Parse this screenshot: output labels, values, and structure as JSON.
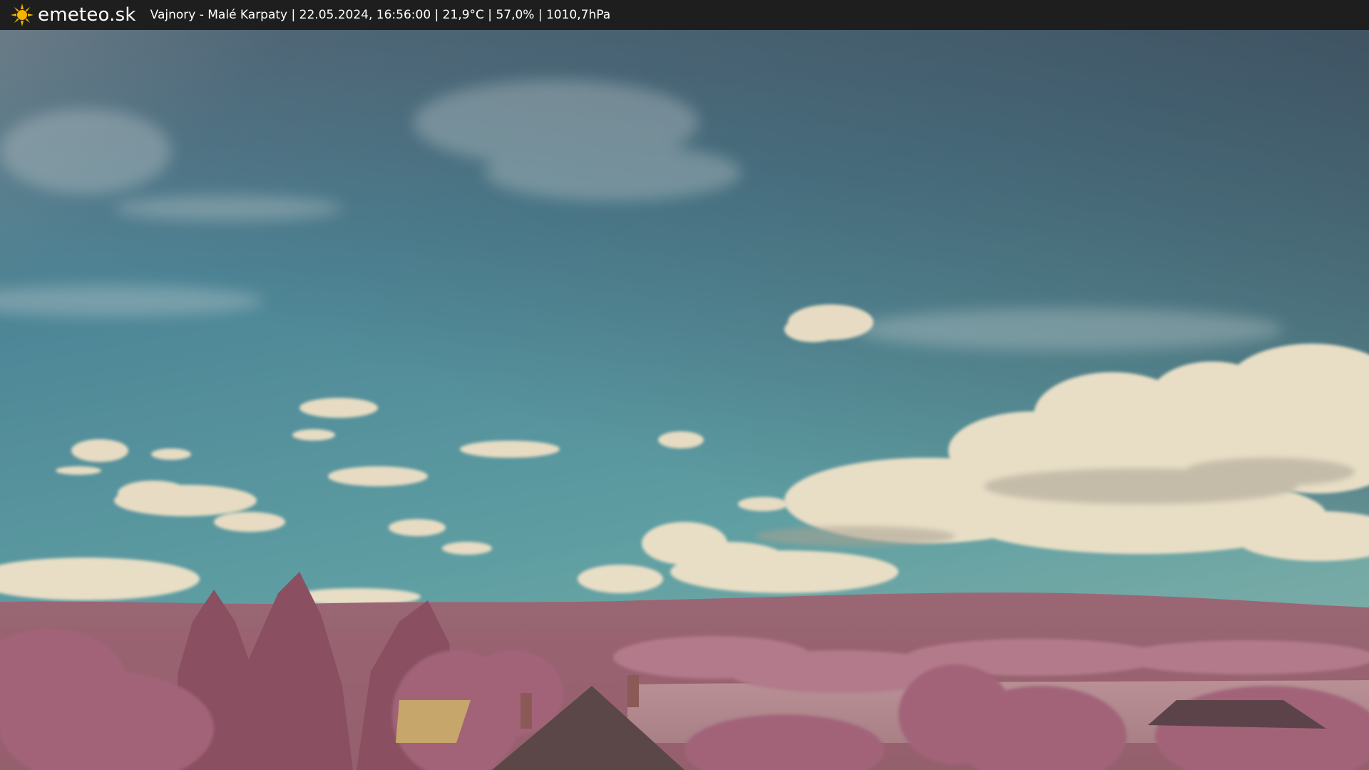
{
  "site": {
    "logo_text": "emeteo.sk",
    "logo_icon": "sun-icon",
    "accent_color": "#f5b400"
  },
  "overlay": {
    "caption": "Vajnory - Malé Karpaty | 22.05.2024, 16:56:00 | 21,9°C | 57,0% | 1010,7hPa"
  },
  "scene": {
    "description_kind": "infrared webcam view",
    "sky_color_top": "#3e5467",
    "sky_color_mid": "#4c8a98",
    "sky_color_horizon": "#6fa7a7",
    "vegetation_color": "#a86b7e",
    "cloud_color": "#e6dcc2"
  }
}
